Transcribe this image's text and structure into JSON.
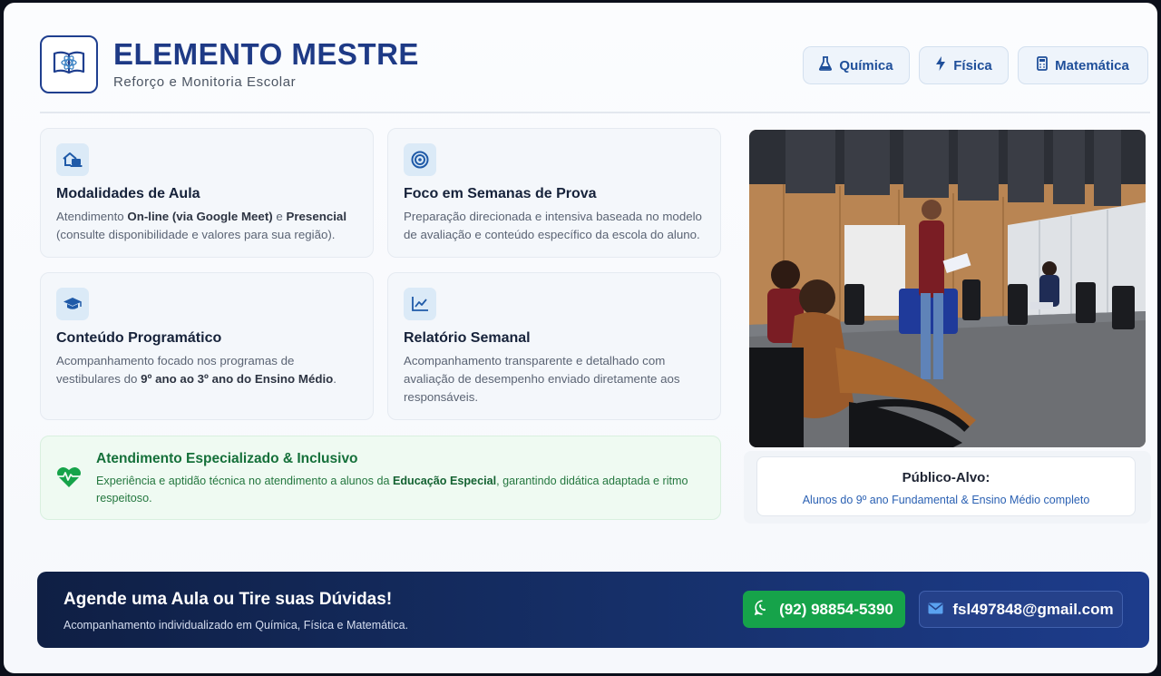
{
  "header": {
    "title": "ELEMENTO MESTRE",
    "subtitle": "Reforço e Monitoria Escolar",
    "logo_icon": "open-book-atom-icon",
    "subjects": [
      {
        "label": "Química",
        "icon": "flask-icon"
      },
      {
        "label": "Física",
        "icon": "lightning-icon"
      },
      {
        "label": "Matemática",
        "icon": "calculator-icon"
      }
    ]
  },
  "features": [
    {
      "title": "Modalidades de Aula",
      "icon": "home-laptop-icon",
      "desc_a": "Atendimento ",
      "desc_b": "On-line (via Google Meet)",
      "desc_c": " e ",
      "desc_d": "Presencial",
      "desc_e": " (consulte disponibilidade e valores para sua região)."
    },
    {
      "title": "Foco em Semanas de Prova",
      "icon": "target-icon",
      "desc": "Preparação direcionada e intensiva baseada no modelo de avaliação e conteúdo específico da escola do aluno."
    },
    {
      "title": "Conteúdo Programático",
      "icon": "graduation-cap-icon",
      "desc_a": "Acompanhamento focado nos programas de vestibulares do ",
      "desc_b": "9º ano ao 3º ano do Ensino Médio",
      "desc_c": "."
    },
    {
      "title": "Relatório Semanal",
      "icon": "chart-line-icon",
      "desc": "Acompanhamento transparente e detalhado com avaliação de desempenho enviado diretamente aos responsáveis."
    }
  ],
  "inclusive": {
    "title": "Atendimento Especializado & Inclusivo",
    "icon": "heart-pulse-icon",
    "desc_a": "Experiência e aptidão técnica no atendimento a alunos da ",
    "desc_b": "Educação Especial",
    "desc_c": ", garantindo didática adaptada e ritmo respeitoso."
  },
  "audience": {
    "title": "Público-Alvo:",
    "text": "Alunos do 9º ano Fundamental & Ensino Médio completo"
  },
  "cta": {
    "title": "Agende uma Aula ou Tire suas Dúvidas!",
    "subtitle": "Acompanhamento individualizado em Química, Física e Matemática.",
    "phone": "(92) 98854-5390",
    "email": "fsl497848@gmail.com"
  },
  "colors": {
    "brand": "#1e3a86",
    "accent": "#1f4f9a",
    "green": "#16a34a",
    "footer": "#0f1f44"
  }
}
